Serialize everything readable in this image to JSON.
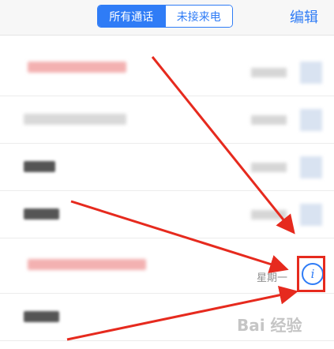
{
  "tabs": {
    "all_calls": "所有通话",
    "missed_calls": "未接来电"
  },
  "edit_label": "编辑",
  "highlighted_row": {
    "day": "星期一",
    "info_icon_glyph": "i"
  },
  "watermark": "Bai 经验",
  "annotation_color": "#e62a1e",
  "accent_color": "#2f7cf6"
}
